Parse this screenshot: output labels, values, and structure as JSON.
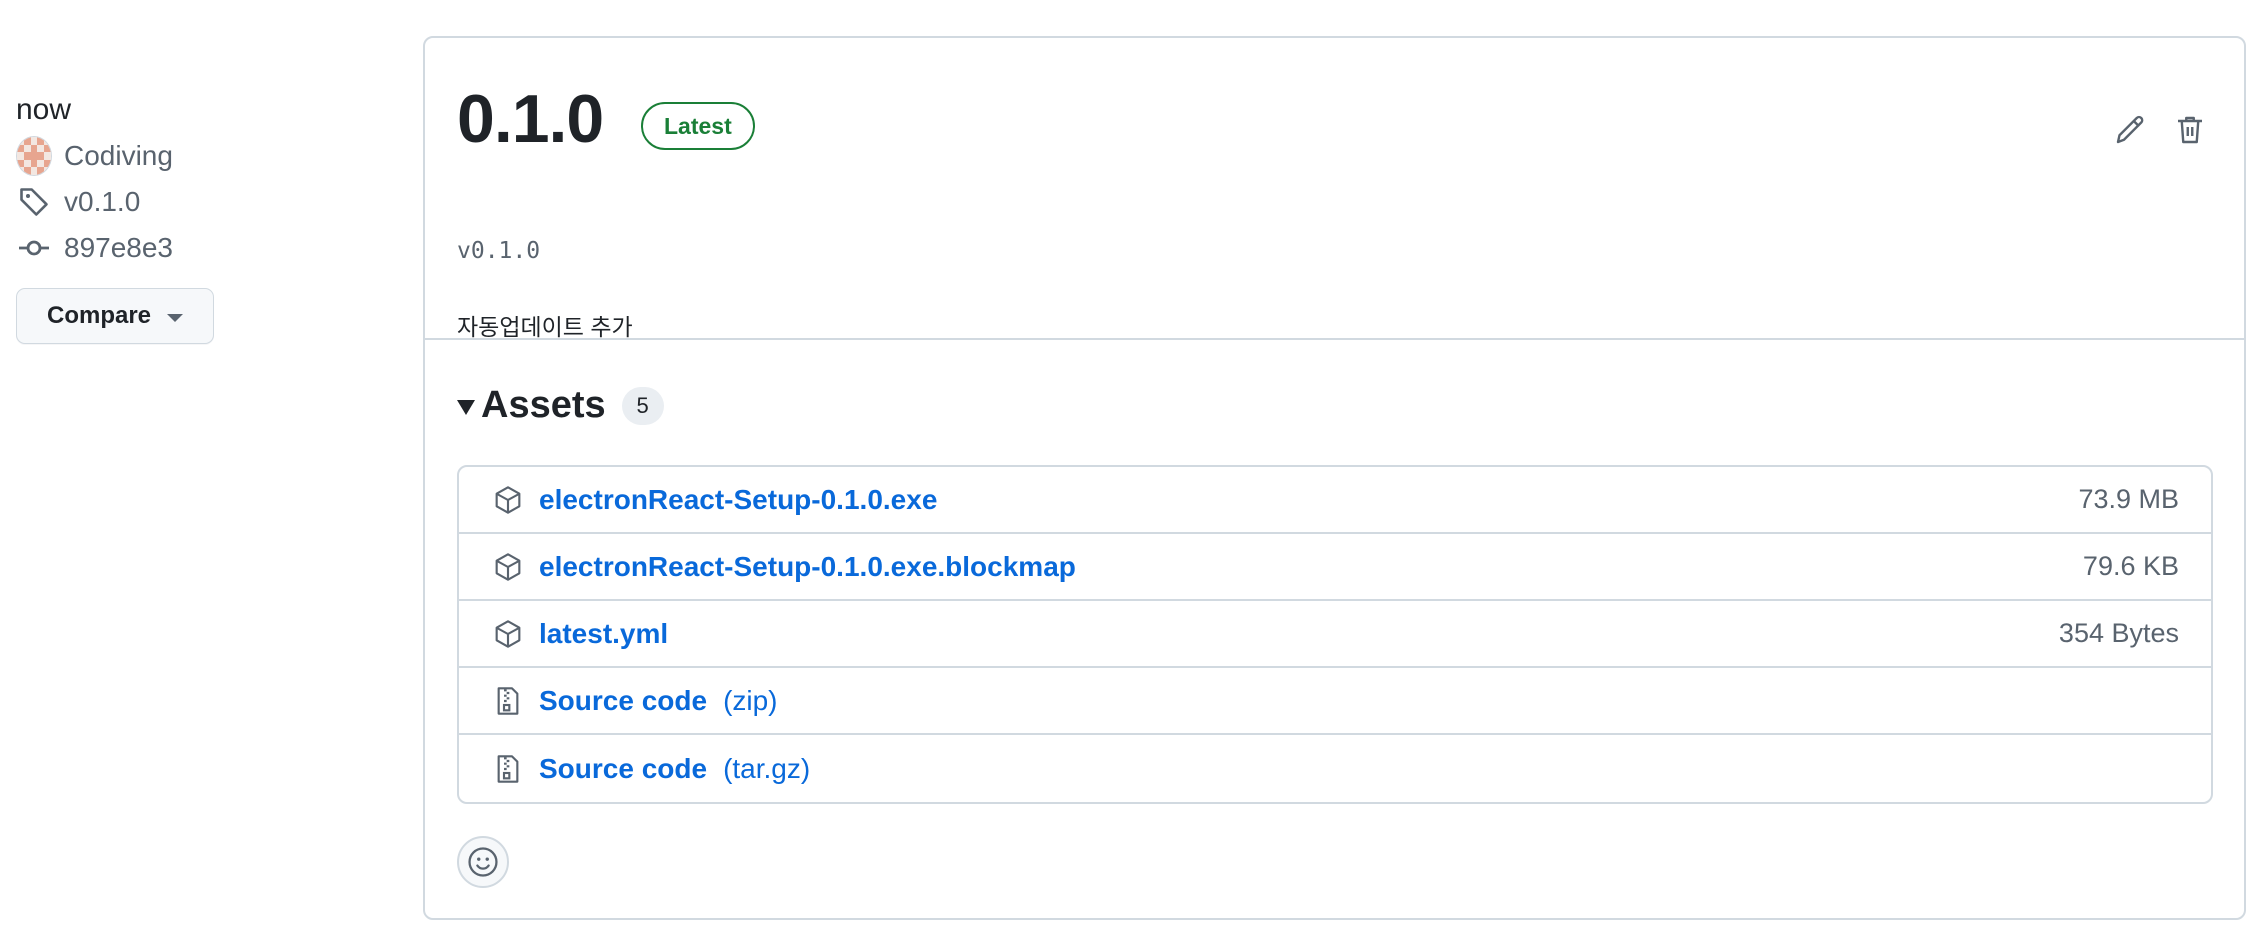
{
  "meta": {
    "when": "now",
    "author": "Codiving",
    "tag": "v0.1.0",
    "commit": "897e8e3",
    "compare_label": "Compare"
  },
  "release": {
    "version": "0.1.0",
    "badge": "Latest",
    "tag_name": "v0.1.0",
    "notes": "자동업데이트 추가",
    "icons": [
      "pencil-icon",
      "trash-icon"
    ]
  },
  "assets": {
    "title": "Assets",
    "count": "5",
    "items": [
      {
        "name": "electronReact-Setup-0.1.0.exe",
        "sub": "",
        "size": "73.9 MB",
        "icon": "package-icon"
      },
      {
        "name": "electronReact-Setup-0.1.0.exe.blockmap",
        "sub": "",
        "size": "79.6 KB",
        "icon": "package-icon"
      },
      {
        "name": "latest.yml",
        "sub": "",
        "size": "354 Bytes",
        "icon": "package-icon"
      },
      {
        "name": "Source code",
        "sub": "(zip)",
        "size": "",
        "icon": "file-zip-icon"
      },
      {
        "name": "Source code",
        "sub": "(tar.gz)",
        "size": "",
        "icon": "file-zip-icon"
      }
    ]
  },
  "colors": {
    "link": "#0969da",
    "latest_green": "#1a7f37",
    "muted": "#59636e",
    "border": "#d1d9e0"
  }
}
